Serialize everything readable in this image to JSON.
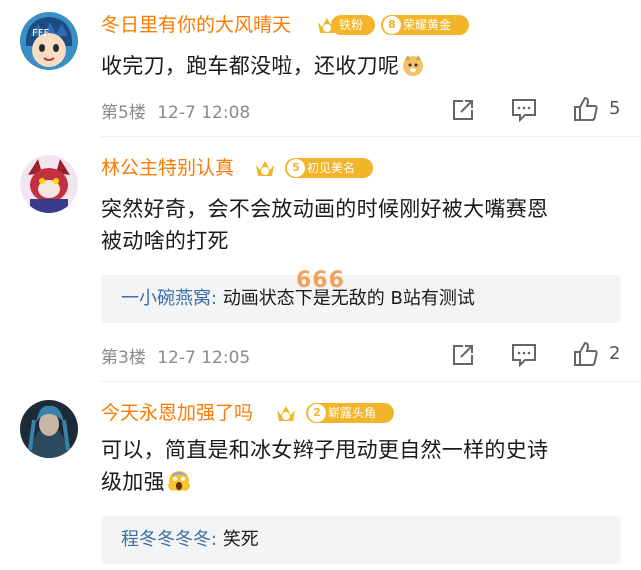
{
  "comments": [
    {
      "username": "冬日里有你的大风晴天",
      "crown_level": "6",
      "badge1_label": "铁粉",
      "badge2_num": "8",
      "badge2_label": "荣耀黄金",
      "text": "收完刀，跑车都没啦，还收刀呢",
      "emoji": "doge-emoji",
      "floor": "第5楼",
      "time": "12-7 12:08",
      "likes": "5"
    },
    {
      "username": "林公主特别认真",
      "badge2_num": "5",
      "badge2_label": "初见美名",
      "text_line1": "突然好奇，会不会放动画的时候刚好被大嘴赛恩",
      "text_line2": "被动啥的打死",
      "reply_name": "一小碗燕窝:",
      "reply_text": "动画状态下是无敌的 B站有测试",
      "floor": "第3楼",
      "time": "12-7 12:05",
      "likes": "2"
    },
    {
      "username": "今天永恩加强了吗",
      "badge2_num": "2",
      "badge2_label": "崭露头角",
      "text_line1": "可以，简直是和冰女辫子甩动更自然一样的史诗",
      "text_line2": "级加强",
      "emoji": "scream-emoji",
      "reply_name": "程冬冬冬冬:",
      "reply_text": "笑死"
    }
  ],
  "overlay_text": "666",
  "colors": {
    "username": "#ff7a00",
    "gold_badge": "#f2b529",
    "reply_name": "#3c6fa8",
    "meta": "#8a8a8a"
  }
}
